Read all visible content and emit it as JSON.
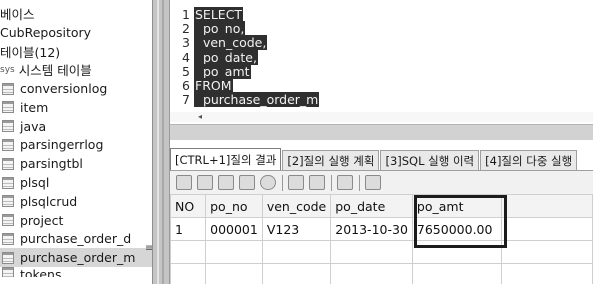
{
  "navigator": {
    "items": [
      {
        "label": "베이스",
        "icon": "none"
      },
      {
        "label": "CubRepository",
        "icon": "none"
      },
      {
        "label": "테이블(12)",
        "icon": "none"
      },
      {
        "label": "시스템 테이블",
        "prefix": "sys",
        "icon": "system-table-icon"
      },
      {
        "label": "conversionlog",
        "icon": "table-icon"
      },
      {
        "label": "item",
        "icon": "table-icon"
      },
      {
        "label": "java",
        "icon": "table-icon"
      },
      {
        "label": "parsingerrlog",
        "icon": "table-icon"
      },
      {
        "label": "parsingtbl",
        "icon": "table-icon"
      },
      {
        "label": "plsql",
        "icon": "table-icon"
      },
      {
        "label": "plsqlcrud",
        "icon": "table-icon"
      },
      {
        "label": "project",
        "icon": "table-icon"
      },
      {
        "label": "purchase_order_d",
        "icon": "table-icon"
      },
      {
        "label": "purchase_order_m",
        "icon": "table-icon",
        "selected": true
      },
      {
        "label": "tokens",
        "icon": "table-icon"
      }
    ],
    "splitter_glyph": "≡"
  },
  "editor": {
    "line_numbers": [
      "1",
      "2",
      "3",
      "4",
      "5",
      "6",
      "7"
    ],
    "lines": [
      "SELECT",
      "  po_no,",
      "  ven_code,",
      "  po_date,",
      "  po_amt",
      "FROM",
      "  purchase_order_m"
    ],
    "scroll_left_arrow": "◂"
  },
  "result_tabs": [
    {
      "label": "[CTRL+1]질의 결과",
      "active": true
    },
    {
      "label": "[2]질의 실행 계획",
      "active": false
    },
    {
      "label": "[3]SQL 실행 이력",
      "active": false
    },
    {
      "label": "[4]질의 다중 실행",
      "active": false
    }
  ],
  "toolbar": {
    "icons": [
      "edit-icon",
      "insert-row-icon",
      "delete-row-icon",
      "commit-icon",
      "refresh-icon",
      "export-icon",
      "import-icon",
      "copy-icon",
      "filter-icon"
    ]
  },
  "result_grid": {
    "columns": [
      "NO",
      "po_no",
      "ven_code",
      "po_date",
      "po_amt"
    ],
    "rows": [
      [
        "1",
        "000001",
        "V123",
        "2013-10-30",
        "7650000.00"
      ]
    ],
    "highlight_column": "po_amt"
  },
  "colors": {
    "editor_highlight": "#2f2f2f",
    "selected_nav_row": "#d6d6d6",
    "pane_divider": "#c4c4c4"
  }
}
